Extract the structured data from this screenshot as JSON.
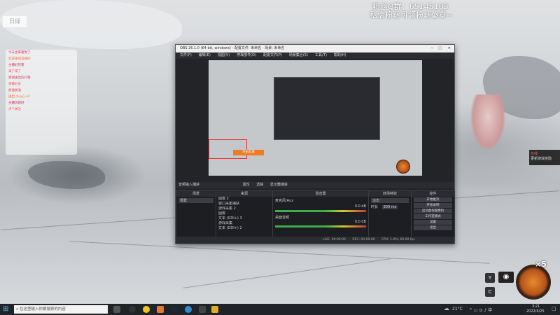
{
  "overlay": {
    "qq_group": "粉丝Q群：65145103",
    "follow_tip": "私信粉丝可领粉丝徽章~",
    "top_left_badge": "日绿"
  },
  "obs": {
    "title": "OBS 26.1.0 (64-bit, windows) - 配置文件: 未命名 - 场景: 未命名",
    "menu": [
      "文件(F)",
      "编辑(E)",
      "视图(V)",
      "停靠部件(D)",
      "配置文件(P)",
      "场景集合(S)",
      "工具(T)",
      "帮助(H)"
    ],
    "preview_button": "点击此处",
    "source_bar": {
      "audio_input": "音频输入捕获",
      "props": "属性",
      "filters": "滤镜",
      "display": "显示器捕获"
    },
    "docks": {
      "scenes": {
        "header": "场景",
        "items": [
          "场景"
        ]
      },
      "sources": {
        "header": "来源",
        "items": [
          "图像 2",
          "窗口采集捕获",
          "游戏采集 2",
          "图像",
          "文本 (GDI+) 3",
          "游戏采集",
          "文本 (GDI+) 2"
        ]
      },
      "mixer": {
        "header": "混音器",
        "tracks": [
          {
            "name": "麦克风/Aux",
            "db": "0.0 dB"
          },
          {
            "name": "桌面音频",
            "db": "0.0 dB"
          }
        ]
      },
      "transitions": {
        "header": "转场特效",
        "type": "淡出",
        "duration_label": "时长",
        "duration": "300 ms"
      },
      "controls": {
        "header": "控件",
        "buttons": [
          "开始推流",
          "开始录制",
          "启动虚拟摄像机",
          "工作室模式",
          "设置",
          "退出"
        ]
      }
    },
    "status": {
      "live": "LIVE: 00:00:00",
      "rec": "REC: 00:00:00",
      "cpu": "CPU: 1.0%, 60.00 fps"
    }
  },
  "chat": {
    "lines": [
      "今天也来看你了",
      "欢迎来到直播间",
      "主播好厉害",
      "来了来了",
      "感谢送出的礼物",
      "弹幕好多",
      "加油加油",
      "送出 小心心 x1",
      "主播玩得好",
      "点个关注"
    ]
  },
  "right_panel": {
    "label": "在线",
    "sub": "更新游戏奖励"
  },
  "hud": {
    "y_key": "Y",
    "c_key": "C",
    "multiplier": "×5"
  },
  "taskbar": {
    "search_placeholder": "在这里输入你要搜索的内容",
    "weather": "21°C",
    "time": "3:21",
    "date": "2022/4/25"
  }
}
